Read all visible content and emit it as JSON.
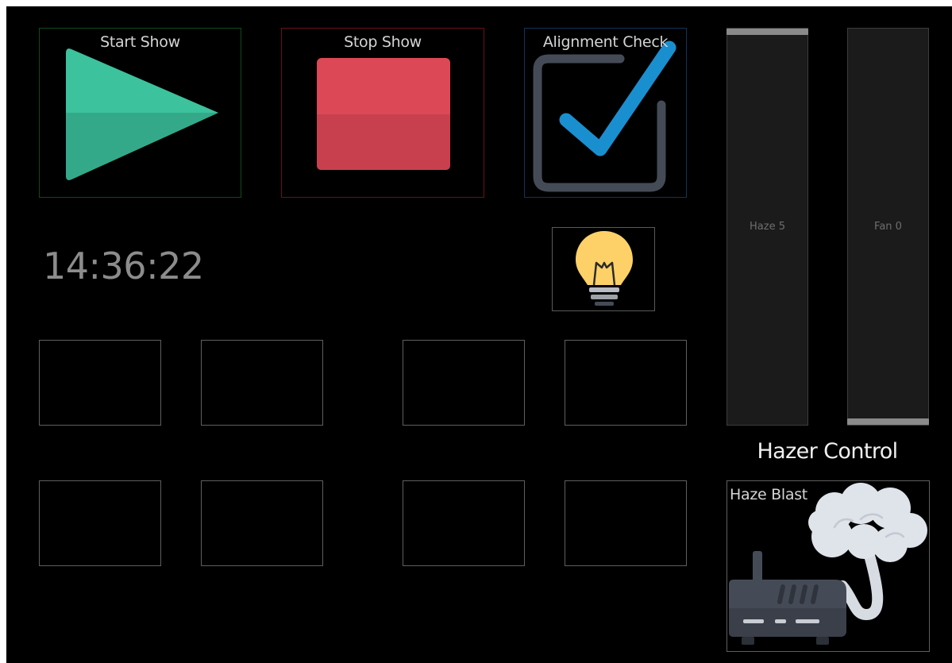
{
  "buttons": {
    "start_show": "Start Show",
    "stop_show": "Stop Show",
    "alignment_check": "Alignment Check",
    "haze_blast": "Haze Blast"
  },
  "clock": {
    "time": "14:36:22"
  },
  "faders": [
    {
      "label": "Haze 5",
      "value": 5,
      "level": 1.0
    },
    {
      "label": "Fan 0",
      "value": 0,
      "level": 0.0
    }
  ],
  "hazer": {
    "title": "Hazer Control"
  },
  "icons": {
    "start": "play-icon",
    "stop": "stop-icon",
    "alignment": "checkbox-check-icon",
    "light": "lightbulb-icon",
    "haze": "hazer-machine-smoke-icon"
  },
  "colors": {
    "background": "#000000",
    "play": "#3cc29c",
    "stop": "#dc4856",
    "check": "#1a8fd0",
    "checkbox": "#454b56",
    "bulb": "#fdd167",
    "smoke": "#dfe3ea",
    "machine": "#454b56"
  },
  "empty_buttons_count": 8
}
